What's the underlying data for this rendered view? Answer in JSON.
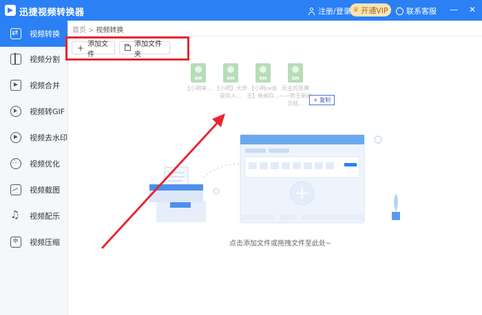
{
  "app": {
    "title": "迅捷视频转换器"
  },
  "header": {
    "login": "注册/登录",
    "vip": "开通VIP",
    "service": "联系客服"
  },
  "sidebar": {
    "items": [
      {
        "label": "视频转换",
        "icon": "convert-icon",
        "active": true
      },
      {
        "label": "视频分割",
        "icon": "split-icon"
      },
      {
        "label": "视频合并",
        "icon": "merge-icon"
      },
      {
        "label": "视频转GIF",
        "icon": "gif-icon"
      },
      {
        "label": "视频去水印",
        "icon": "watermark-icon"
      },
      {
        "label": "视频优化",
        "icon": "optimize-icon"
      },
      {
        "label": "视频截图",
        "icon": "screenshot-icon"
      },
      {
        "label": "视频配乐",
        "icon": "music-icon"
      },
      {
        "label": "视频压缩",
        "icon": "compress-icon"
      }
    ]
  },
  "breadcrumb": {
    "home": "首页",
    "separator": ">",
    "current": "视频转换"
  },
  "toolbar": {
    "add_file": "添加文件",
    "add_folder": "添加文件夹"
  },
  "drag_files": [
    {
      "name": "【小明来...",
      "type": "RM"
    },
    {
      "name": "【小明】大师是存入...",
      "type": "RM"
    },
    {
      "name": "【小明ce会王】新闻存...",
      "type": "RM"
    },
    {
      "name": "无主的恩典——转王新闻文档...",
      "type": "RM"
    }
  ],
  "copy_badge": "+ 复制",
  "empty_hint": "点击添加文件或拖拽文件至此处~",
  "colors": {
    "accent": "#2b80f4",
    "highlight": "#e8262d",
    "arrow": "#e8262d",
    "vip_bg": "#fbe3b2"
  }
}
